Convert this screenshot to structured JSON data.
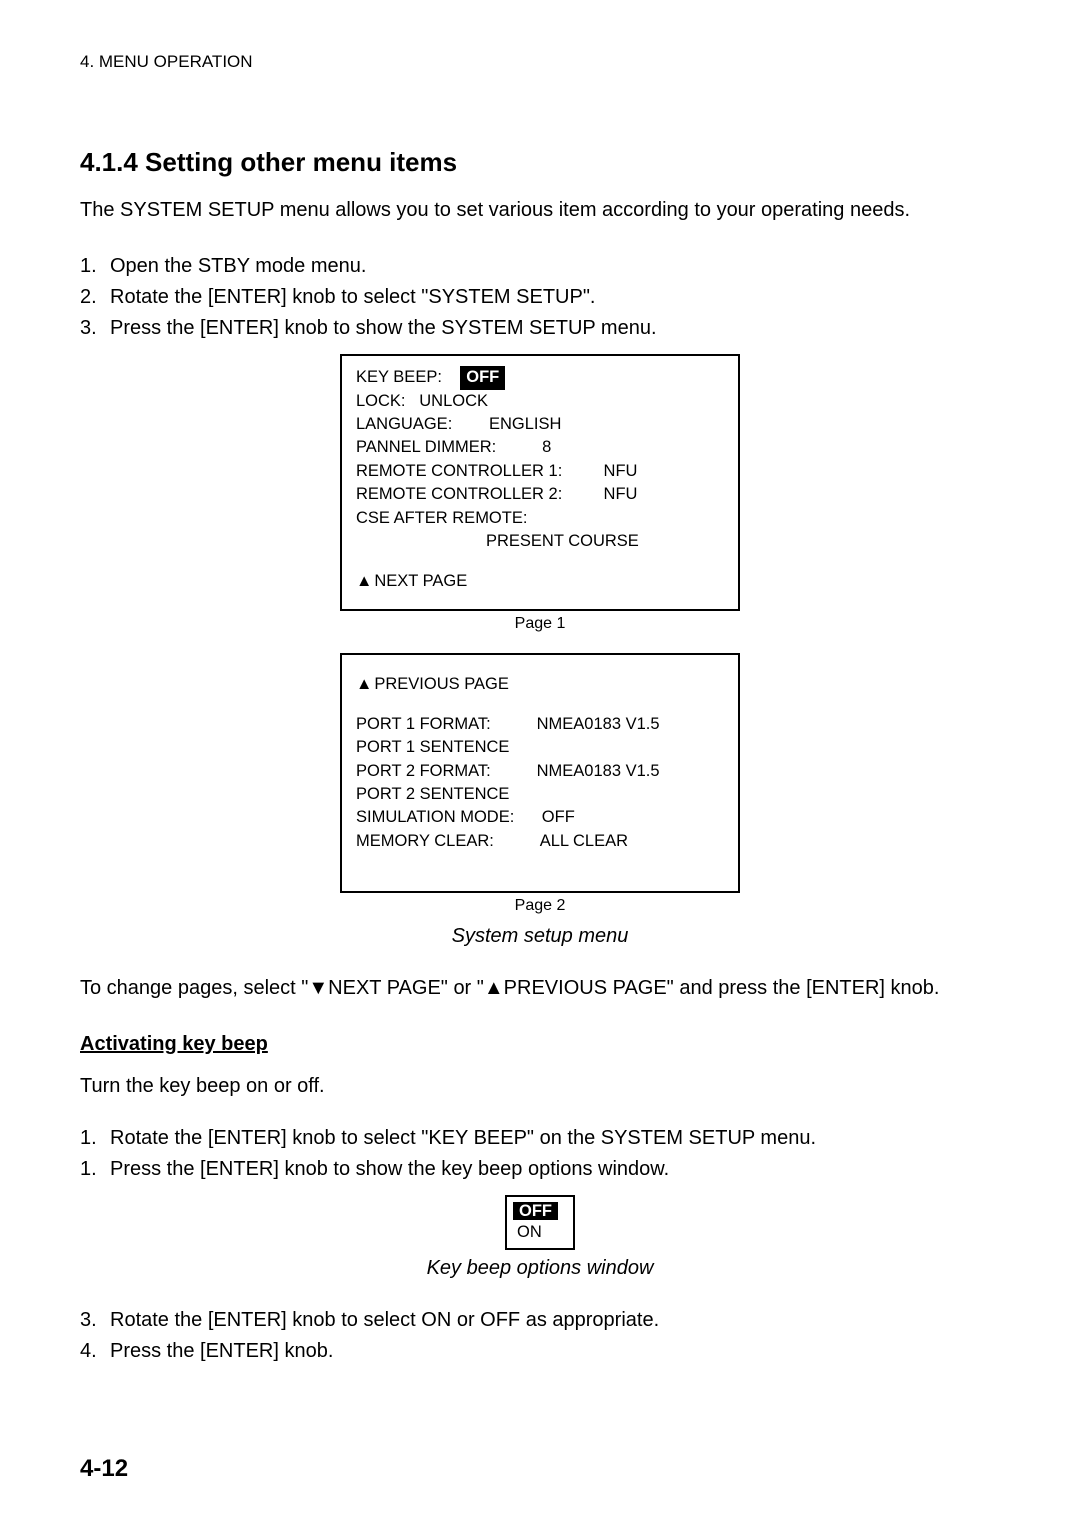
{
  "header": "4. MENU OPERATION",
  "section_heading": "4.1.4   Setting other menu items",
  "intro": "The SYSTEM SETUP menu allows you to set various item according to your operating needs.",
  "steps1": [
    {
      "n": "1.",
      "t": "Open the STBY mode menu."
    },
    {
      "n": "2.",
      "t": "Rotate the [ENTER] knob to select \"SYSTEM SETUP\"."
    },
    {
      "n": "3.",
      "t": "Press the [ENTER] knob to show the SYSTEM SETUP menu."
    }
  ],
  "panel1": {
    "rows": [
      {
        "label": "KEY BEEP:",
        "value": "OFF",
        "highlight": true,
        "gap": "    "
      },
      {
        "label": "LOCK:   UNLOCK",
        "value": ""
      },
      {
        "label": "LANGUAGE:        ENGLISH",
        "value": ""
      },
      {
        "label": "PANNEL DIMMER:          8",
        "value": ""
      },
      {
        "label": "REMOTE CONTROLLER 1:         NFU",
        "value": ""
      },
      {
        "label": "REMOTE CONTROLLER 2:         NFU",
        "value": ""
      },
      {
        "label": "CSE AFTER REMOTE:",
        "value": ""
      },
      {
        "label": "",
        "value": "PRESENT COURSE",
        "indent": true
      }
    ],
    "next_page": "NEXT PAGE",
    "caption": "Page 1"
  },
  "panel2": {
    "prev_page": "PREVIOUS PAGE",
    "rows": [
      {
        "label": "PORT 1 FORMAT:",
        "value": "NMEA0183 V1.5",
        "gap": "          "
      },
      {
        "label": "PORT 1 SENTENCE",
        "value": ""
      },
      {
        "label": "PORT 2 FORMAT:",
        "value": "NMEA0183 V1.5",
        "gap": "          "
      },
      {
        "label": "PORT 2 SENTENCE",
        "value": ""
      },
      {
        "label": "SIMULATION MODE:",
        "value": "OFF",
        "gap": "      "
      },
      {
        "label": "MEMORY CLEAR:",
        "value": "ALL CLEAR",
        "gap": "          "
      }
    ],
    "caption": "Page 2"
  },
  "figure_caption": "System setup menu",
  "change_pages_text": "To change pages, select \"▼NEXT PAGE\" or \"▲PREVIOUS PAGE\" and press the [ENTER] knob.",
  "sub_heading": "Activating key beep",
  "sub_text": "Turn the key beep on or off.",
  "steps2": [
    {
      "n": "1.",
      "t": "Rotate the [ENTER] knob to select \"KEY BEEP\" on the SYSTEM SETUP menu."
    },
    {
      "n": "1.",
      "t": "Press the [ENTER] knob to show the key beep options window."
    }
  ],
  "options": {
    "off": "OFF",
    "on": "ON"
  },
  "options_caption": "Key beep options window",
  "steps3": [
    {
      "n": "3.",
      "t": "Rotate the [ENTER] knob to select ON or OFF as appropriate."
    },
    {
      "n": "4.",
      "t": "Press the [ENTER] knob."
    }
  ],
  "page_number": "4-12"
}
